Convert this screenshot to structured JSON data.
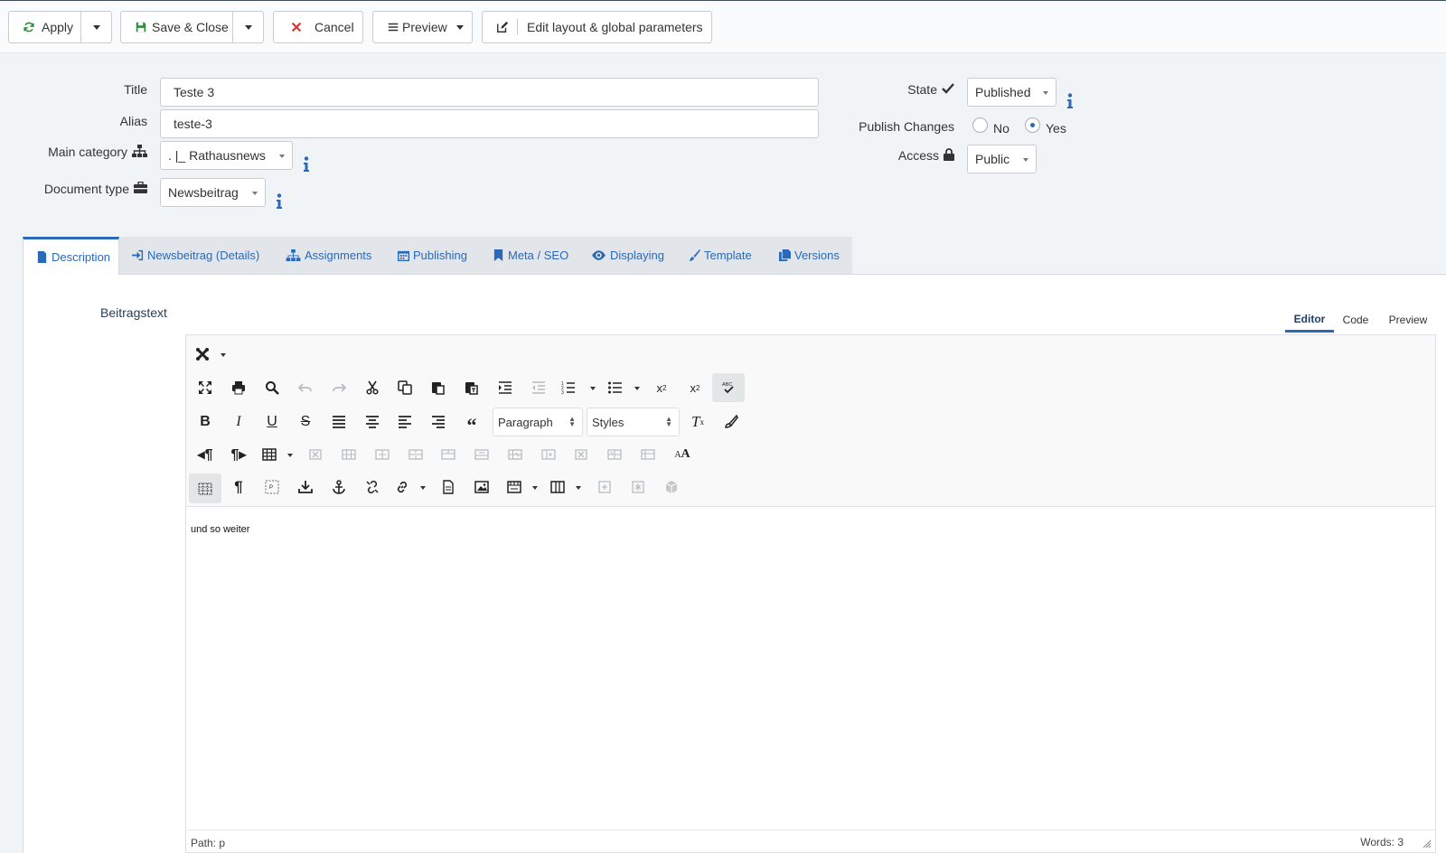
{
  "toolbar": {
    "apply": "Apply",
    "save_close": "Save & Close",
    "cancel": "Cancel",
    "preview": "Preview",
    "edit_layout": "Edit layout & global parameters"
  },
  "form": {
    "title_label": "Title",
    "title_value": "Teste 3",
    "alias_label": "Alias",
    "alias_value": "teste-3",
    "main_category_label": "Main category",
    "main_category_value": ". |_ Rathausnews",
    "document_type_label": "Document type",
    "document_type_value": "Newsbeitrag",
    "state_label": "State",
    "state_value": "Published",
    "publish_changes_label": "Publish Changes",
    "publish_no": "No",
    "publish_yes": "Yes",
    "publish_selected": "Yes",
    "access_label": "Access",
    "access_value": "Public"
  },
  "tabs": [
    "Description",
    "Newsbeitrag (Details)",
    "Assignments",
    "Publishing",
    "Meta / SEO",
    "Displaying",
    "Template",
    "Versions"
  ],
  "active_tab": "Description",
  "editor": {
    "field_label": "Beitragstext",
    "mode_tabs": [
      "Editor",
      "Code",
      "Preview"
    ],
    "active_mode": "Editor",
    "block_format": "Paragraph",
    "styles": "Styles",
    "content": "und so weiter",
    "path_label": "Path: p",
    "word_count": "Words: 3"
  },
  "colors": {
    "accent": "#2a69b8",
    "cancel_icon": "#d9312b",
    "background": "#f1f4f7"
  }
}
